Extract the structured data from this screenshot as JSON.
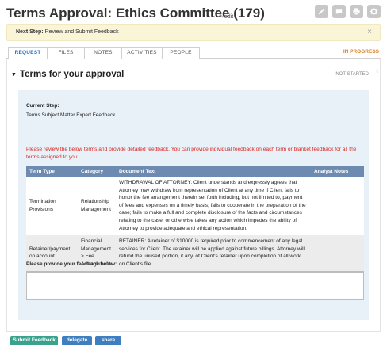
{
  "header": {
    "title": "Terms Approval: Ethics Committee (179)",
    "edit_label": "edit",
    "tools": [
      "pencil-icon",
      "comment-icon",
      "print-icon",
      "gear-icon"
    ]
  },
  "next_step": {
    "label": "Next Step:",
    "text": "Review and Submit Feedback",
    "close": "×"
  },
  "tabs": [
    {
      "label": "REQUEST"
    },
    {
      "label": "FILES"
    },
    {
      "label": "NOTES"
    },
    {
      "label": "ACTIVITIES"
    },
    {
      "label": "PEOPLE"
    }
  ],
  "status": "IN PROGRESS",
  "section": {
    "title": "Terms for your approval",
    "state": "NOT STARTED"
  },
  "current_step": {
    "label": "Current Step:",
    "value": "Terms Subject Matter Expert Feedback"
  },
  "instruction": "Please review the below terms and provide detailed feedback. You can provide individual feedback on each term or blanket feedback for all the terms assigned to you.",
  "table": {
    "headers": [
      "Term Type",
      "Category",
      "Document Text",
      "Analyst Notes"
    ],
    "rows": [
      {
        "term_type": "Termination Provisions",
        "category": "Relationship Management",
        "text": "WITHDRAWAL OF ATTORNEY: Client understands and expressly agrees that Attorney may withdraw from representation of Client at any time if Client fails to honor the fee arrangement therein set forth including, but not limited to, payment of fees and expenses on a timely basis; fails to cooperate in the preparation of the case; fails to make a full and complete disclosure of the facts and circumstances relating to the case; or otherwise takes any action which impedes the ability of Attorney to provide adequate and ethical representation.",
        "notes": ""
      },
      {
        "term_type": "Retainer/payment on account",
        "category": "Financial Management > Fee Arrangement",
        "text": "RETAINER: A retainer of $10000 is required prior to commencement of any legal services for Client. The retainer will be applied against future billings. Attorney will refund the unused portion, if any, of Client's retainer upon completion of all work on Client's file.",
        "notes": ""
      }
    ]
  },
  "feedback": {
    "label": "Please provide your feedback below:",
    "value": ""
  },
  "buttons": {
    "submit": "Submit Feedback",
    "delegate": "delegate",
    "share": "share"
  }
}
